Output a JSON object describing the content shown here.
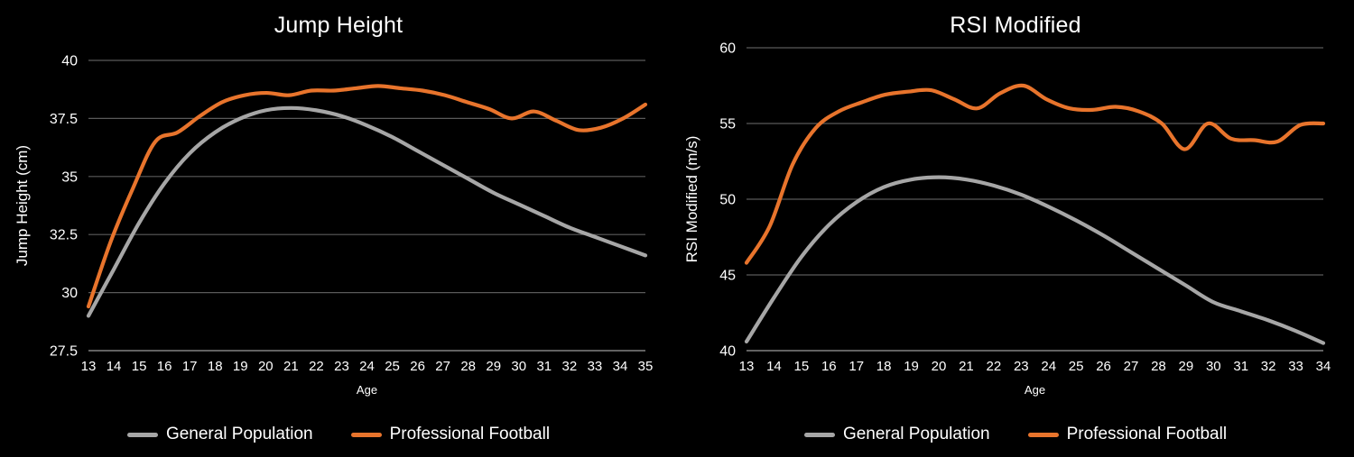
{
  "theme": {
    "background": "#000000",
    "text": "#ffffff",
    "grid": "#8a8a8a",
    "series_general": "#a6a6a6",
    "series_football": "#e8742c"
  },
  "panels": [
    {
      "key": "jump_height",
      "title": "Jump Height",
      "axis_x_label": "Age",
      "axis_y_label": "Jump Height (cm)",
      "legend": [
        {
          "label": "General Population",
          "color": "#a6a6a6"
        },
        {
          "label": "Professional Football",
          "color": "#e8742c"
        }
      ]
    },
    {
      "key": "rsi_modified",
      "title": "RSI Modified",
      "axis_x_label": "Age",
      "axis_y_label": "RSI Modified (m/s)",
      "legend": [
        {
          "label": "General Population",
          "color": "#a6a6a6"
        },
        {
          "label": "Professional Football",
          "color": "#e8742c"
        }
      ]
    }
  ],
  "chart_data": [
    {
      "type": "line",
      "title": "Jump Height",
      "xlabel": "Age",
      "ylabel": "Jump Height (cm)",
      "xlim": [
        13,
        35
      ],
      "ylim": [
        27.5,
        40
      ],
      "yticks": [
        27.5,
        30,
        32.5,
        35,
        37.5,
        40
      ],
      "ytick_labels": [
        "27.5",
        "30",
        "32.5",
        "35",
        "37.5",
        "40"
      ],
      "x": [
        13,
        14,
        15,
        16,
        17,
        18,
        19,
        20,
        21,
        22,
        23,
        24,
        25,
        26,
        27,
        28,
        29,
        30,
        31,
        32,
        33,
        34,
        35
      ],
      "xtick_labels": [
        "13",
        "14",
        "15",
        "16",
        "17",
        "18",
        "19",
        "20",
        "21",
        "22",
        "23",
        "24",
        "25",
        "26",
        "27",
        "28",
        "29",
        "30",
        "31",
        "32",
        "33",
        "34",
        "35"
      ],
      "grid": true,
      "legend_position": "bottom",
      "series": [
        {
          "name": "General Population",
          "color": "#a6a6a6",
          "values": [
            29.0,
            31.0,
            33.0,
            34.7,
            36.0,
            36.9,
            37.5,
            37.85,
            37.95,
            37.85,
            37.6,
            37.2,
            36.7,
            36.1,
            35.5,
            34.9,
            34.3,
            33.8,
            33.3,
            32.8,
            32.4,
            32.0,
            31.6
          ]
        },
        {
          "name": "Professional Football",
          "color": "#e8742c",
          "values": [
            29.4,
            32.2,
            34.5,
            36.5,
            36.9,
            37.6,
            38.2,
            38.5,
            38.6,
            38.5,
            38.7,
            38.7,
            38.8,
            38.9,
            38.8,
            38.7,
            38.5,
            38.2,
            37.9,
            37.5,
            37.8,
            37.4,
            37.0,
            37.1,
            37.5,
            38.1
          ]
        }
      ]
    },
    {
      "type": "line",
      "title": "RSI Modified",
      "xlabel": "Age",
      "ylabel": "RSI Modified (m/s)",
      "xlim": [
        13,
        34
      ],
      "ylim": [
        40,
        60
      ],
      "yticks": [
        40,
        45,
        50,
        55,
        60
      ],
      "ytick_labels": [
        "40",
        "45",
        "50",
        "55",
        "60"
      ],
      "x": [
        13,
        14,
        15,
        16,
        17,
        18,
        19,
        20,
        21,
        22,
        23,
        24,
        25,
        26,
        27,
        28,
        29,
        30,
        31,
        32,
        33,
        34
      ],
      "xtick_labels": [
        "13",
        "14",
        "15",
        "16",
        "17",
        "18",
        "19",
        "20",
        "21",
        "22",
        "23",
        "24",
        "25",
        "26",
        "27",
        "28",
        "29",
        "30",
        "31",
        "32",
        "33",
        "34"
      ],
      "grid": true,
      "legend_position": "bottom",
      "series": [
        {
          "name": "General Population",
          "color": "#a6a6a6",
          "values": [
            40.6,
            43.5,
            46.2,
            48.3,
            49.8,
            50.8,
            51.3,
            51.45,
            51.3,
            50.9,
            50.3,
            49.5,
            48.6,
            47.6,
            46.5,
            45.4,
            44.3,
            43.2,
            42.6,
            42.0,
            41.3,
            40.5
          ]
        },
        {
          "name": "Professional Football",
          "color": "#e8742c",
          "values": [
            45.8,
            48.2,
            52.3,
            54.7,
            55.8,
            56.4,
            56.9,
            57.1,
            57.2,
            56.6,
            56.0,
            57.0,
            57.5,
            56.6,
            56.0,
            55.9,
            56.1,
            55.8,
            55.0,
            53.3,
            55.0,
            54.0,
            53.9,
            53.8,
            54.9,
            55.0
          ]
        }
      ]
    }
  ]
}
